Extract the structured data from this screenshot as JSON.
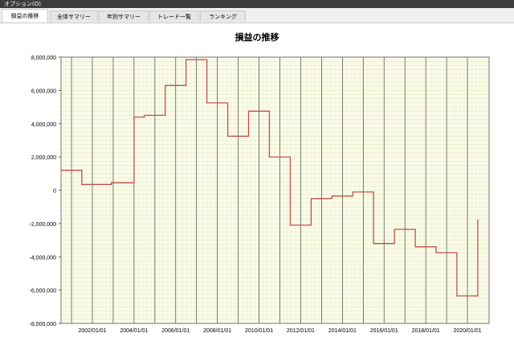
{
  "window": {
    "menu_label": "オプション(O)"
  },
  "tabs": [
    {
      "label": "損益の推移",
      "active": true
    },
    {
      "label": "全体サマリー",
      "active": false
    },
    {
      "label": "年別サマリー",
      "active": false
    },
    {
      "label": "トレード一覧",
      "active": false
    },
    {
      "label": "ランキング",
      "active": false
    }
  ],
  "chart_data": {
    "type": "line",
    "title": "損益の推移",
    "xlabel": "",
    "ylabel": "",
    "ylim": [
      -8000000,
      8000000
    ],
    "yticks": [
      8000000,
      6000000,
      4000000,
      2000000,
      0,
      -2000000,
      -4000000,
      -6000000,
      -8000000
    ],
    "ytick_labels": [
      "8,000,000",
      "6,000,000",
      "4,000,000",
      "2,000,000",
      "0",
      "-2,000,000",
      "-4,000,000",
      "-6,000,000",
      "-8,000,000"
    ],
    "xlim": [
      "2000-07-01",
      "2021-01-15"
    ],
    "xticks": [
      "2002-01-01",
      "2004-01-01",
      "2006-01-01",
      "2008-01-01",
      "2010-01-01",
      "2012-01-01",
      "2014-01-01",
      "2016-01-01",
      "2018-01-01",
      "2020-01-01"
    ],
    "xtick_labels": [
      "2002/01/01",
      "2004/01/01",
      "2006/01/01",
      "2008/01/01",
      "2010/01/01",
      "2012/01/01",
      "2014/01/01",
      "2016/01/01",
      "2018/01/01",
      "2020/01/01"
    ],
    "grid": true,
    "colors": {
      "line": "#c0504d",
      "plot_bg": "#fafae8",
      "minor_grid": "#cfe3a8",
      "major_grid": "#444444"
    },
    "series": [
      {
        "name": "",
        "x": [
          "2000-07-01",
          "2001-07-01",
          "2001-07-01",
          "2002-12-01",
          "2002-12-01",
          "2004-01-01",
          "2004-01-01",
          "2004-07-01",
          "2004-07-01",
          "2005-07-01",
          "2005-07-01",
          "2006-07-01",
          "2006-07-01",
          "2007-07-01",
          "2007-07-01",
          "2008-07-01",
          "2008-07-01",
          "2009-07-01",
          "2009-07-01",
          "2010-07-01",
          "2010-07-01",
          "2011-07-01",
          "2011-07-01",
          "2012-07-01",
          "2012-07-01",
          "2013-07-01",
          "2013-07-01",
          "2014-07-01",
          "2014-07-01",
          "2015-07-01",
          "2015-07-01",
          "2016-07-01",
          "2016-07-01",
          "2017-07-01",
          "2017-07-01",
          "2018-07-01",
          "2018-07-01",
          "2019-07-01",
          "2019-07-01",
          "2020-07-01",
          "2020-07-01"
        ],
        "y": [
          1200000,
          1200000,
          350000,
          350000,
          450000,
          450000,
          4400000,
          4400000,
          4500000,
          4500000,
          6300000,
          6300000,
          7850000,
          7850000,
          5250000,
          5250000,
          3250000,
          3250000,
          4750000,
          4750000,
          2000000,
          2000000,
          -2100000,
          -2100000,
          -500000,
          -500000,
          -350000,
          -350000,
          -100000,
          -100000,
          -3200000,
          -3200000,
          -2350000,
          -2350000,
          -3400000,
          -3400000,
          -3750000,
          -3750000,
          -6350000,
          -6350000,
          -1750000
        ]
      }
    ]
  }
}
